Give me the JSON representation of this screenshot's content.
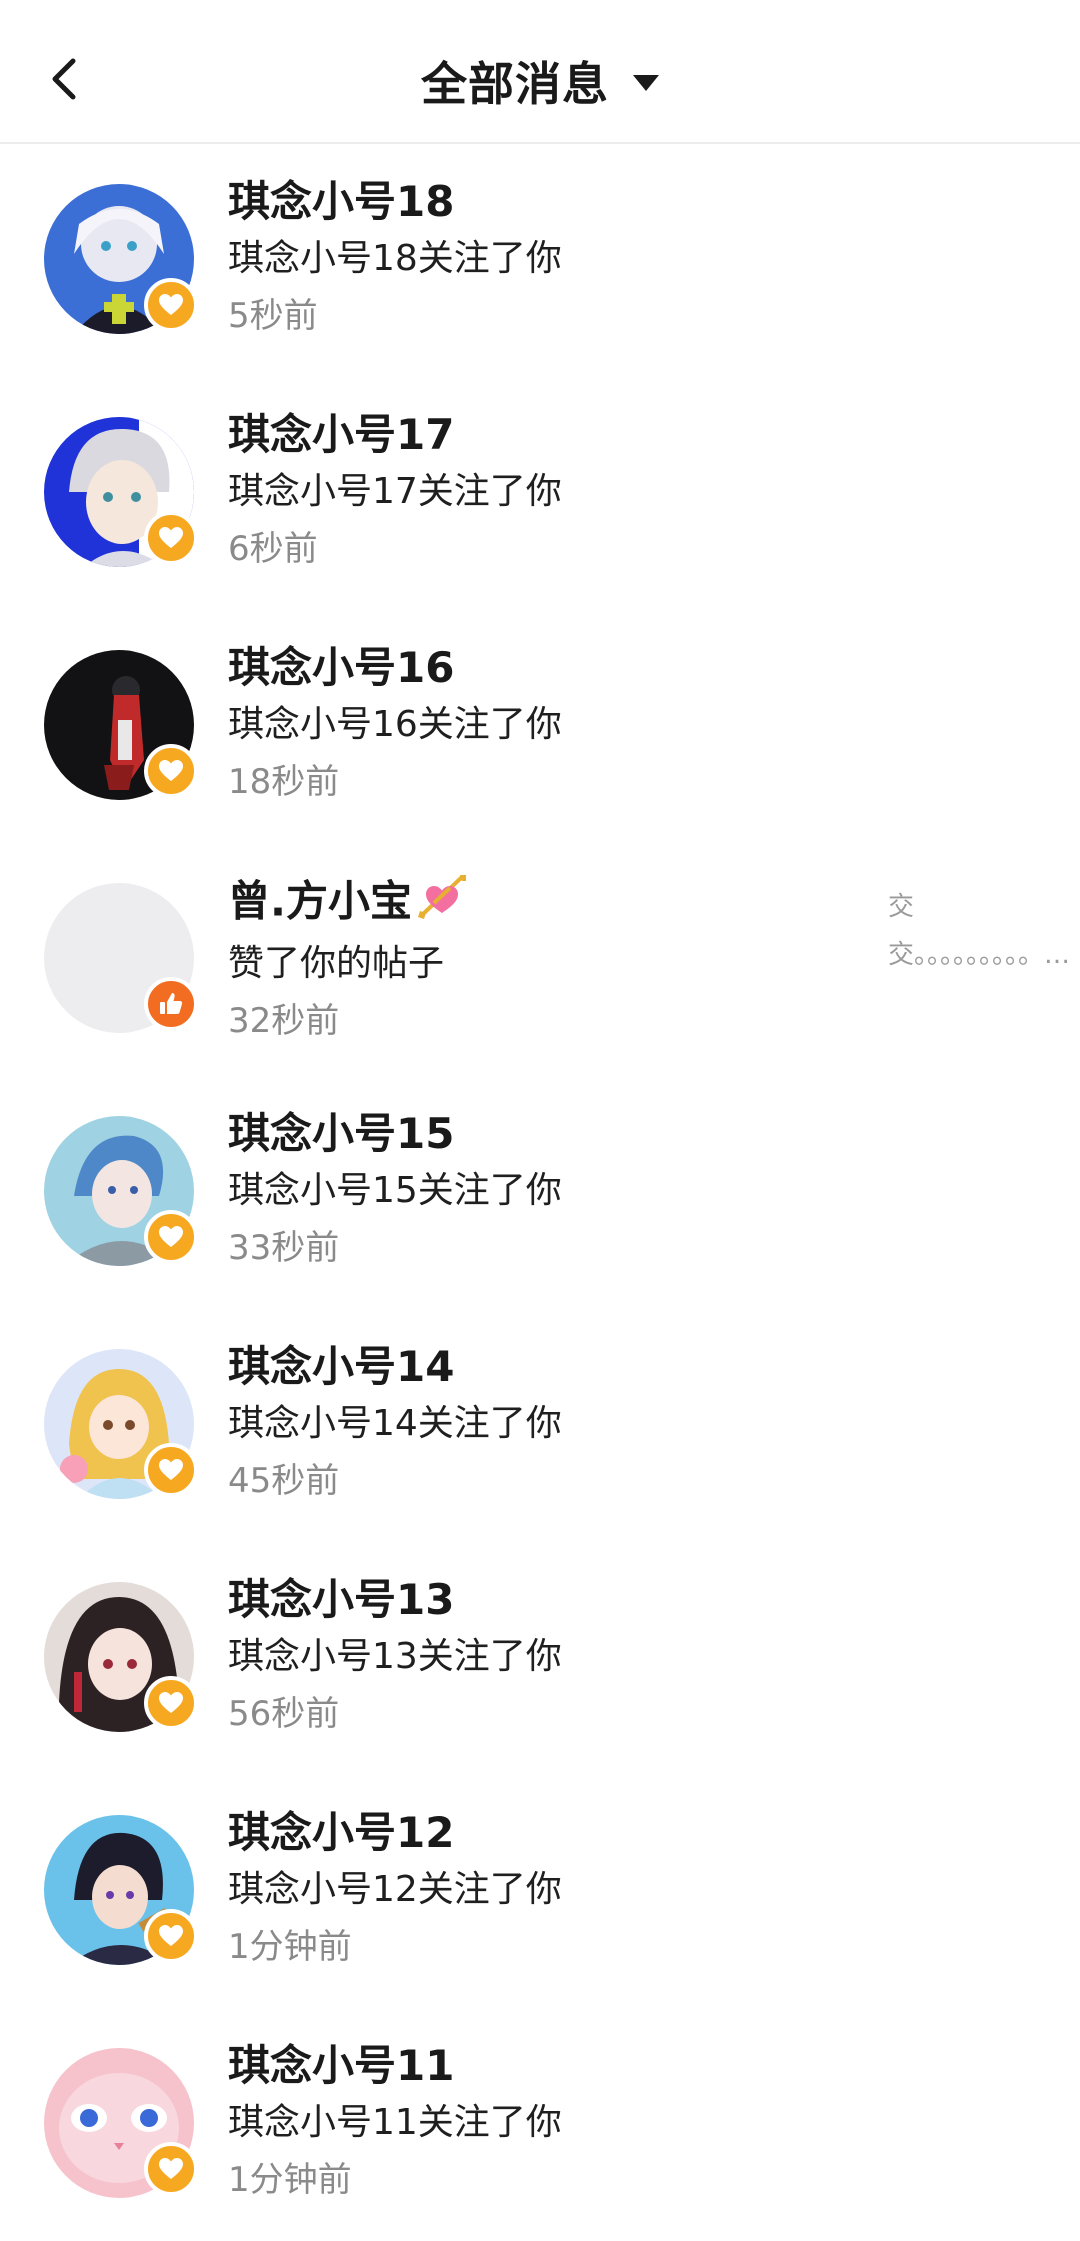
{
  "header": {
    "title": "全部消息",
    "back_icon": "chevron-left-icon",
    "dropdown_icon": "caret-down-icon"
  },
  "colors": {
    "follow_badge": "#f7a821",
    "like_badge": "#f26d21",
    "time_text": "#8a8a8a"
  },
  "messages": [
    {
      "name": "琪念小号18",
      "action": "琪念小号18关注了你",
      "time": "5秒前",
      "type": "follow"
    },
    {
      "name": "琪念小号17",
      "action": "琪念小号17关注了你",
      "time": "6秒前",
      "type": "follow"
    },
    {
      "name": "琪念小号16",
      "action": "琪念小号16关注了你",
      "time": "18秒前",
      "type": "follow"
    },
    {
      "name": "曾.方小宝",
      "action": "赞了你的帖子",
      "time": "32秒前",
      "type": "like",
      "name_emoji": "heart-with-arrow-icon",
      "post_preview": "交交。。。。。。。。。…"
    },
    {
      "name": "琪念小号15",
      "action": "琪念小号15关注了你",
      "time": "33秒前",
      "type": "follow"
    },
    {
      "name": "琪念小号14",
      "action": "琪念小号14关注了你",
      "time": "45秒前",
      "type": "follow"
    },
    {
      "name": "琪念小号13",
      "action": "琪念小号13关注了你",
      "time": "56秒前",
      "type": "follow"
    },
    {
      "name": "琪念小号12",
      "action": "琪念小号12关注了你",
      "time": "1分钟前",
      "type": "follow"
    },
    {
      "name": "琪念小号11",
      "action": "琪念小号11关注了你",
      "time": "1分钟前",
      "type": "follow"
    }
  ]
}
